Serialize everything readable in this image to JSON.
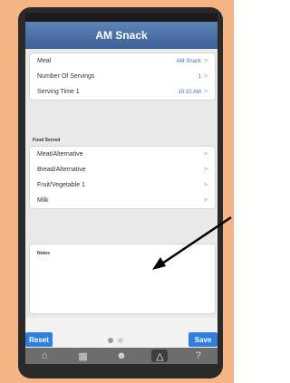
{
  "header": {
    "title": "AM Snack"
  },
  "details": {
    "meal_label": "Meal",
    "meal_value": "AM Snack",
    "servings_label": "Number Of Servings",
    "servings_value": "1",
    "serving_time_label": "Serving Time 1",
    "serving_time_value": "10:10 AM"
  },
  "food_served": {
    "title": "Food Served",
    "items": [
      "Meat/Alternative",
      "Bread/Alternative",
      "Fruit/Vegetable 1",
      "Milk"
    ]
  },
  "notes": {
    "label": "Notes"
  },
  "buttons": {
    "reset": "Reset",
    "save": "Save"
  },
  "chevron": ">",
  "tabs": [
    "home-icon",
    "calendar-icon",
    "people-icon",
    "meals-icon",
    "help-icon"
  ],
  "colors": {
    "title_bar": "#4a6fa5",
    "button": "#2f7fe3",
    "background": "#f4b484"
  }
}
